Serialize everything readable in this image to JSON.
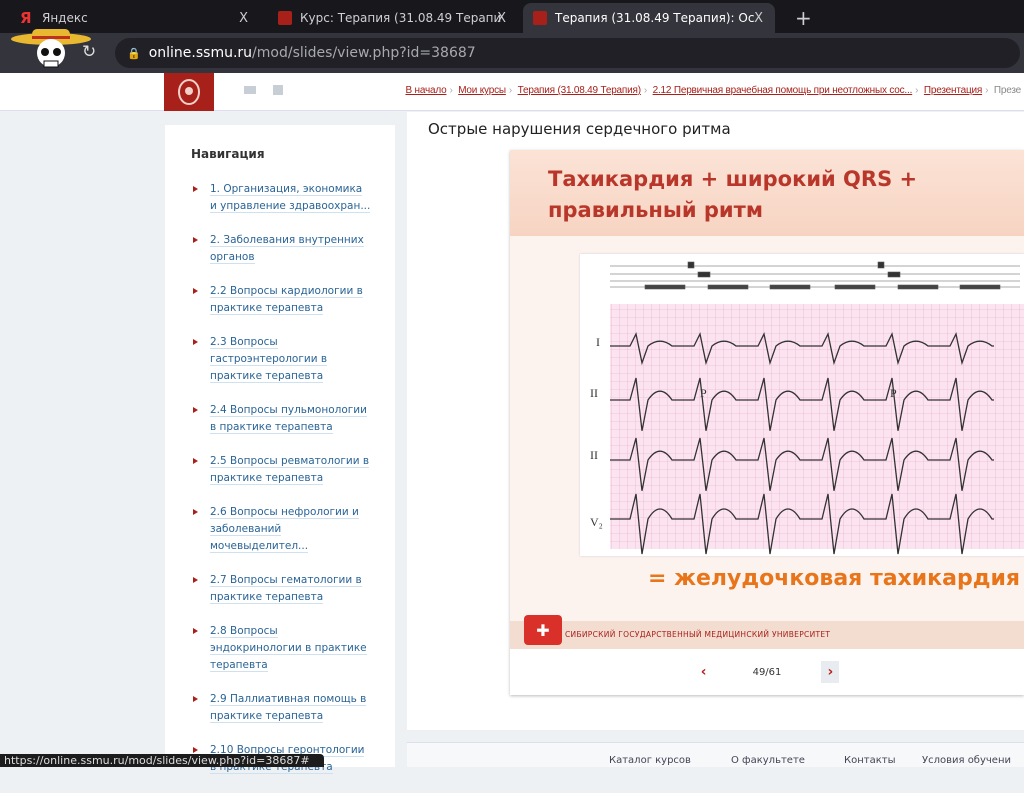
{
  "tabs": [
    {
      "title": "Яндекс"
    },
    {
      "title": "Курс: Терапия (31.08.49 Терапи"
    },
    {
      "title": "Терапия (31.08.49 Терапия): Ос"
    }
  ],
  "new_tab": "+",
  "close": "X",
  "url": {
    "host": "online.ssmu.ru",
    "path": "/mod/slides/view.php?id=38687"
  },
  "breadcrumbs": [
    "В начало",
    "Мои курсы",
    "Терапия (31.08.49 Терапия)",
    "2.12 Первичная врачебная помощь при неотложных сос...",
    "Презентация",
    "Презе"
  ],
  "sidebar": {
    "title": "Навигация",
    "items": [
      "1. Организация, экономика и управление здравоохран...",
      "2. Заболевания внутренних органов",
      "2.2 Вопросы кардиологии в практике терапевта",
      "2.3 Вопросы гастроэнтерологии в практике терапевта",
      "2.4 Вопросы пульмонологии в практике терапевта",
      "2.5 Вопросы ревматологии в практике терапевта",
      "2.6 Вопросы нефрологии и заболеваний мочевыделител...",
      "2.7 Вопросы гематологии в практике терапевта",
      "2.8 Вопросы эндокринологии в практике терапевта",
      "2.9 Паллиативная помощь в практике терапевта",
      "2.10 Вопросы геронтологии в практике терапевта"
    ]
  },
  "main": {
    "title": "Острые нарушения сердечного ритма"
  },
  "slide": {
    "heading_1": "Тахикардия + широкий QRS +",
    "heading_2": "правильный ритм",
    "conclusion": "= желудочковая тахикардия",
    "university": "СИБИРСКИЙ ГОСУДАРСТВЕННЫЙ МЕДИЦИНСКИЙ УНИВЕРСИТЕТ",
    "leads": [
      "I",
      "II",
      "II",
      "V₂"
    ],
    "p_label": "P"
  },
  "pager": {
    "prev": "‹",
    "next": "›",
    "current": "49/61"
  },
  "footer": [
    "Каталог курсов",
    "О факультете",
    "Контакты",
    "Условия обучени"
  ],
  "status_url": "https://online.ssmu.ru/mod/slides/view.php?id=38687#",
  "colors": {
    "brand": "#a8201a",
    "accent": "#e8751a"
  }
}
